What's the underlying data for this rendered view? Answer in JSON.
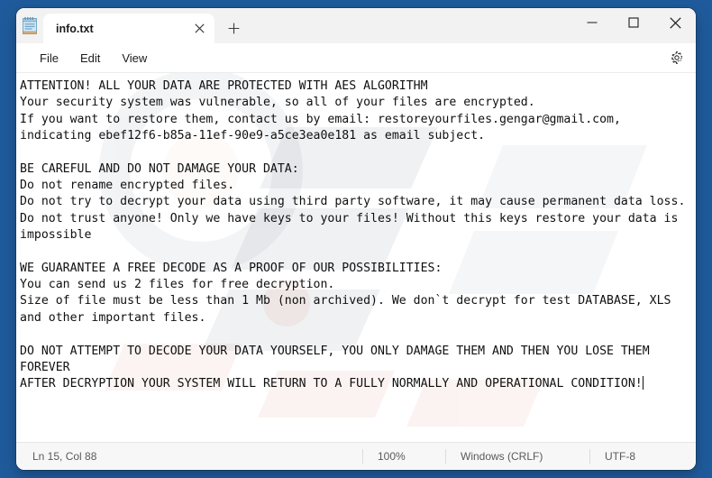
{
  "desktop": {
    "background_color": "#1f5b9c"
  },
  "window": {
    "app_icon": "notepad-icon",
    "controls": {
      "minimize_label": "Minimize",
      "maximize_label": "Maximize",
      "close_label": "Close"
    }
  },
  "tabs": [
    {
      "title": "info.txt",
      "close_label": "Close tab",
      "active": true
    }
  ],
  "new_tab": {
    "label": "+",
    "tooltip": "New tab"
  },
  "menubar": {
    "items": [
      {
        "label": "File"
      },
      {
        "label": "Edit"
      },
      {
        "label": "View"
      }
    ],
    "settings": {
      "icon": "gear-icon",
      "tooltip": "Settings"
    }
  },
  "editor": {
    "content": "ATTENTION! ALL YOUR DATA ARE PROTECTED WITH AES ALGORITHM\nYour security system was vulnerable, so all of your files are encrypted.\nIf you want to restore them, contact us by email: restoreyourfiles.gengar@gmail.com,\nindicating ebef12f6-b85a-11ef-90e9-a5ce3ea0e181 as email subject.\n\nBE CAREFUL AND DO NOT DAMAGE YOUR DATA:\nDo not rename encrypted files.\nDo not try to decrypt your data using third party software, it may cause permanent data loss.\nDo not trust anyone! Only we have keys to your files! Without this keys restore your data is impossible\n\nWE GUARANTEE A FREE DECODE AS A PROOF OF OUR POSSIBILITIES:\nYou can send us 2 files for free decryption.\nSize of file must be less than 1 Mb (non archived). We don`t decrypt for test DATABASE, XLS and other important files.\n\nDO NOT ATTEMPT TO DECODE YOUR DATA YOURSELF, YOU ONLY DAMAGE THEM AND THEN YOU LOSE THEM FOREVER\nAFTER DECRYPTION YOUR SYSTEM WILL RETURN TO A FULLY NORMALLY AND OPERATIONAL CONDITION!"
  },
  "statusbar": {
    "position": "Ln 15, Col 88",
    "zoom": "100%",
    "line_ending": "Windows (CRLF)",
    "encoding": "UTF-8"
  }
}
